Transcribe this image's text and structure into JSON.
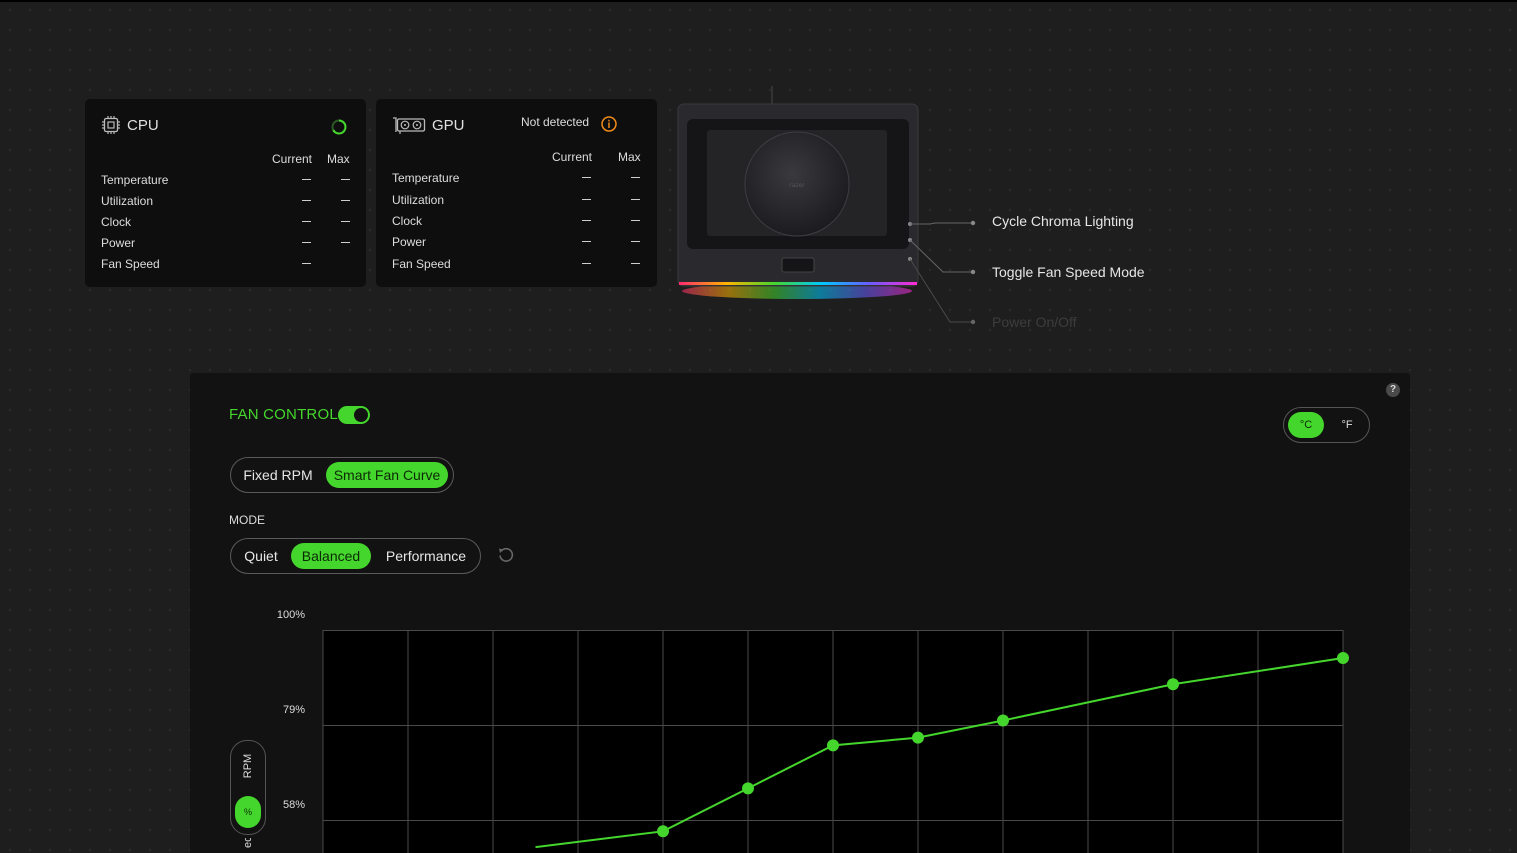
{
  "cpu": {
    "title": "CPU",
    "col_current": "Current",
    "col_max": "Max",
    "rows": [
      "Temperature",
      "Utilization",
      "Clock",
      "Power",
      "Fan Speed"
    ]
  },
  "gpu": {
    "title": "GPU",
    "status": "Not detected",
    "col_current": "Current",
    "col_max": "Max",
    "rows": [
      "Temperature",
      "Utilization",
      "Clock",
      "Power",
      "Fan Speed"
    ]
  },
  "device": {
    "callouts": [
      "Cycle Chroma Lighting",
      "Toggle Fan Speed Mode",
      "Power On/Off"
    ]
  },
  "fan_control": {
    "label": "FAN CONTROL",
    "enabled": true,
    "help": "?",
    "units": {
      "celsius": "°C",
      "fahrenheit": "°F",
      "selected": "°C"
    },
    "control_type": {
      "options": [
        "Fixed RPM",
        "Smart Fan Curve"
      ],
      "selected": "Smart Fan Curve"
    },
    "mode_label": "MODE",
    "modes": {
      "options": [
        "Quiet",
        "Balanced",
        "Performance"
      ],
      "selected": "Balanced"
    },
    "y_axis_toggle": {
      "rpm": "RPM",
      "percent": "%",
      "selected": "%"
    },
    "y_axis_label_partial": "ed"
  },
  "colors": {
    "accent": "#44d62c",
    "warning": "#f08c1a",
    "panel": "#121212",
    "background": "#1e1e1e"
  },
  "icons": {
    "cpu": "cpu-chip-icon",
    "gpu": "gpu-card-icon",
    "warning": "info-circle-icon",
    "reset": "reset-icon",
    "help": "help-icon"
  },
  "chart_data": {
    "type": "line",
    "yticks": [
      "100%",
      "79%",
      "58%"
    ],
    "ylim": [
      0,
      100
    ],
    "grid": true,
    "series": [
      {
        "points": [
          [
            2.5,
            52
          ],
          [
            4,
            55.5
          ],
          [
            5,
            65
          ],
          [
            6,
            74.5
          ],
          [
            7,
            76.2
          ],
          [
            8,
            80
          ],
          [
            10,
            88
          ],
          [
            12,
            93.8
          ]
        ]
      }
    ]
  }
}
